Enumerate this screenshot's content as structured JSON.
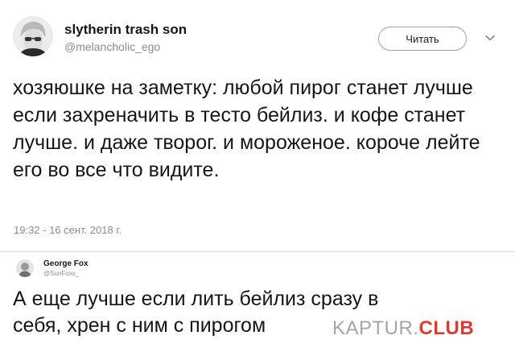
{
  "tweet": {
    "author_name": "slytherin trash son",
    "author_handle": "@melancholic_ego",
    "follow_label": "Читать",
    "text": "хозяюшке на заметку: любой пирог станет лучше если захреначить в тесто бейлиз. и кофе станет лучше. и даже творог. и мороженое. короче лейте его во все что видите.",
    "timestamp": "19:32 - 16 сент. 2018 г.",
    "avatar_icon": "avatar-icon",
    "menu_icon": "chevron-down-icon"
  },
  "reply": {
    "author_name": "George Fox",
    "author_handle": "@SunFoxx_",
    "text": "А еще лучше если лить бейлиз сразу в себя, хрен с ним с пирогом"
  },
  "watermark": {
    "prefix": "KAPTUR.",
    "suffix": "CLUB"
  },
  "colors": {
    "text": "#14171a",
    "secondary": "#8a8d91",
    "watermark_accent": "#e03a2f"
  }
}
